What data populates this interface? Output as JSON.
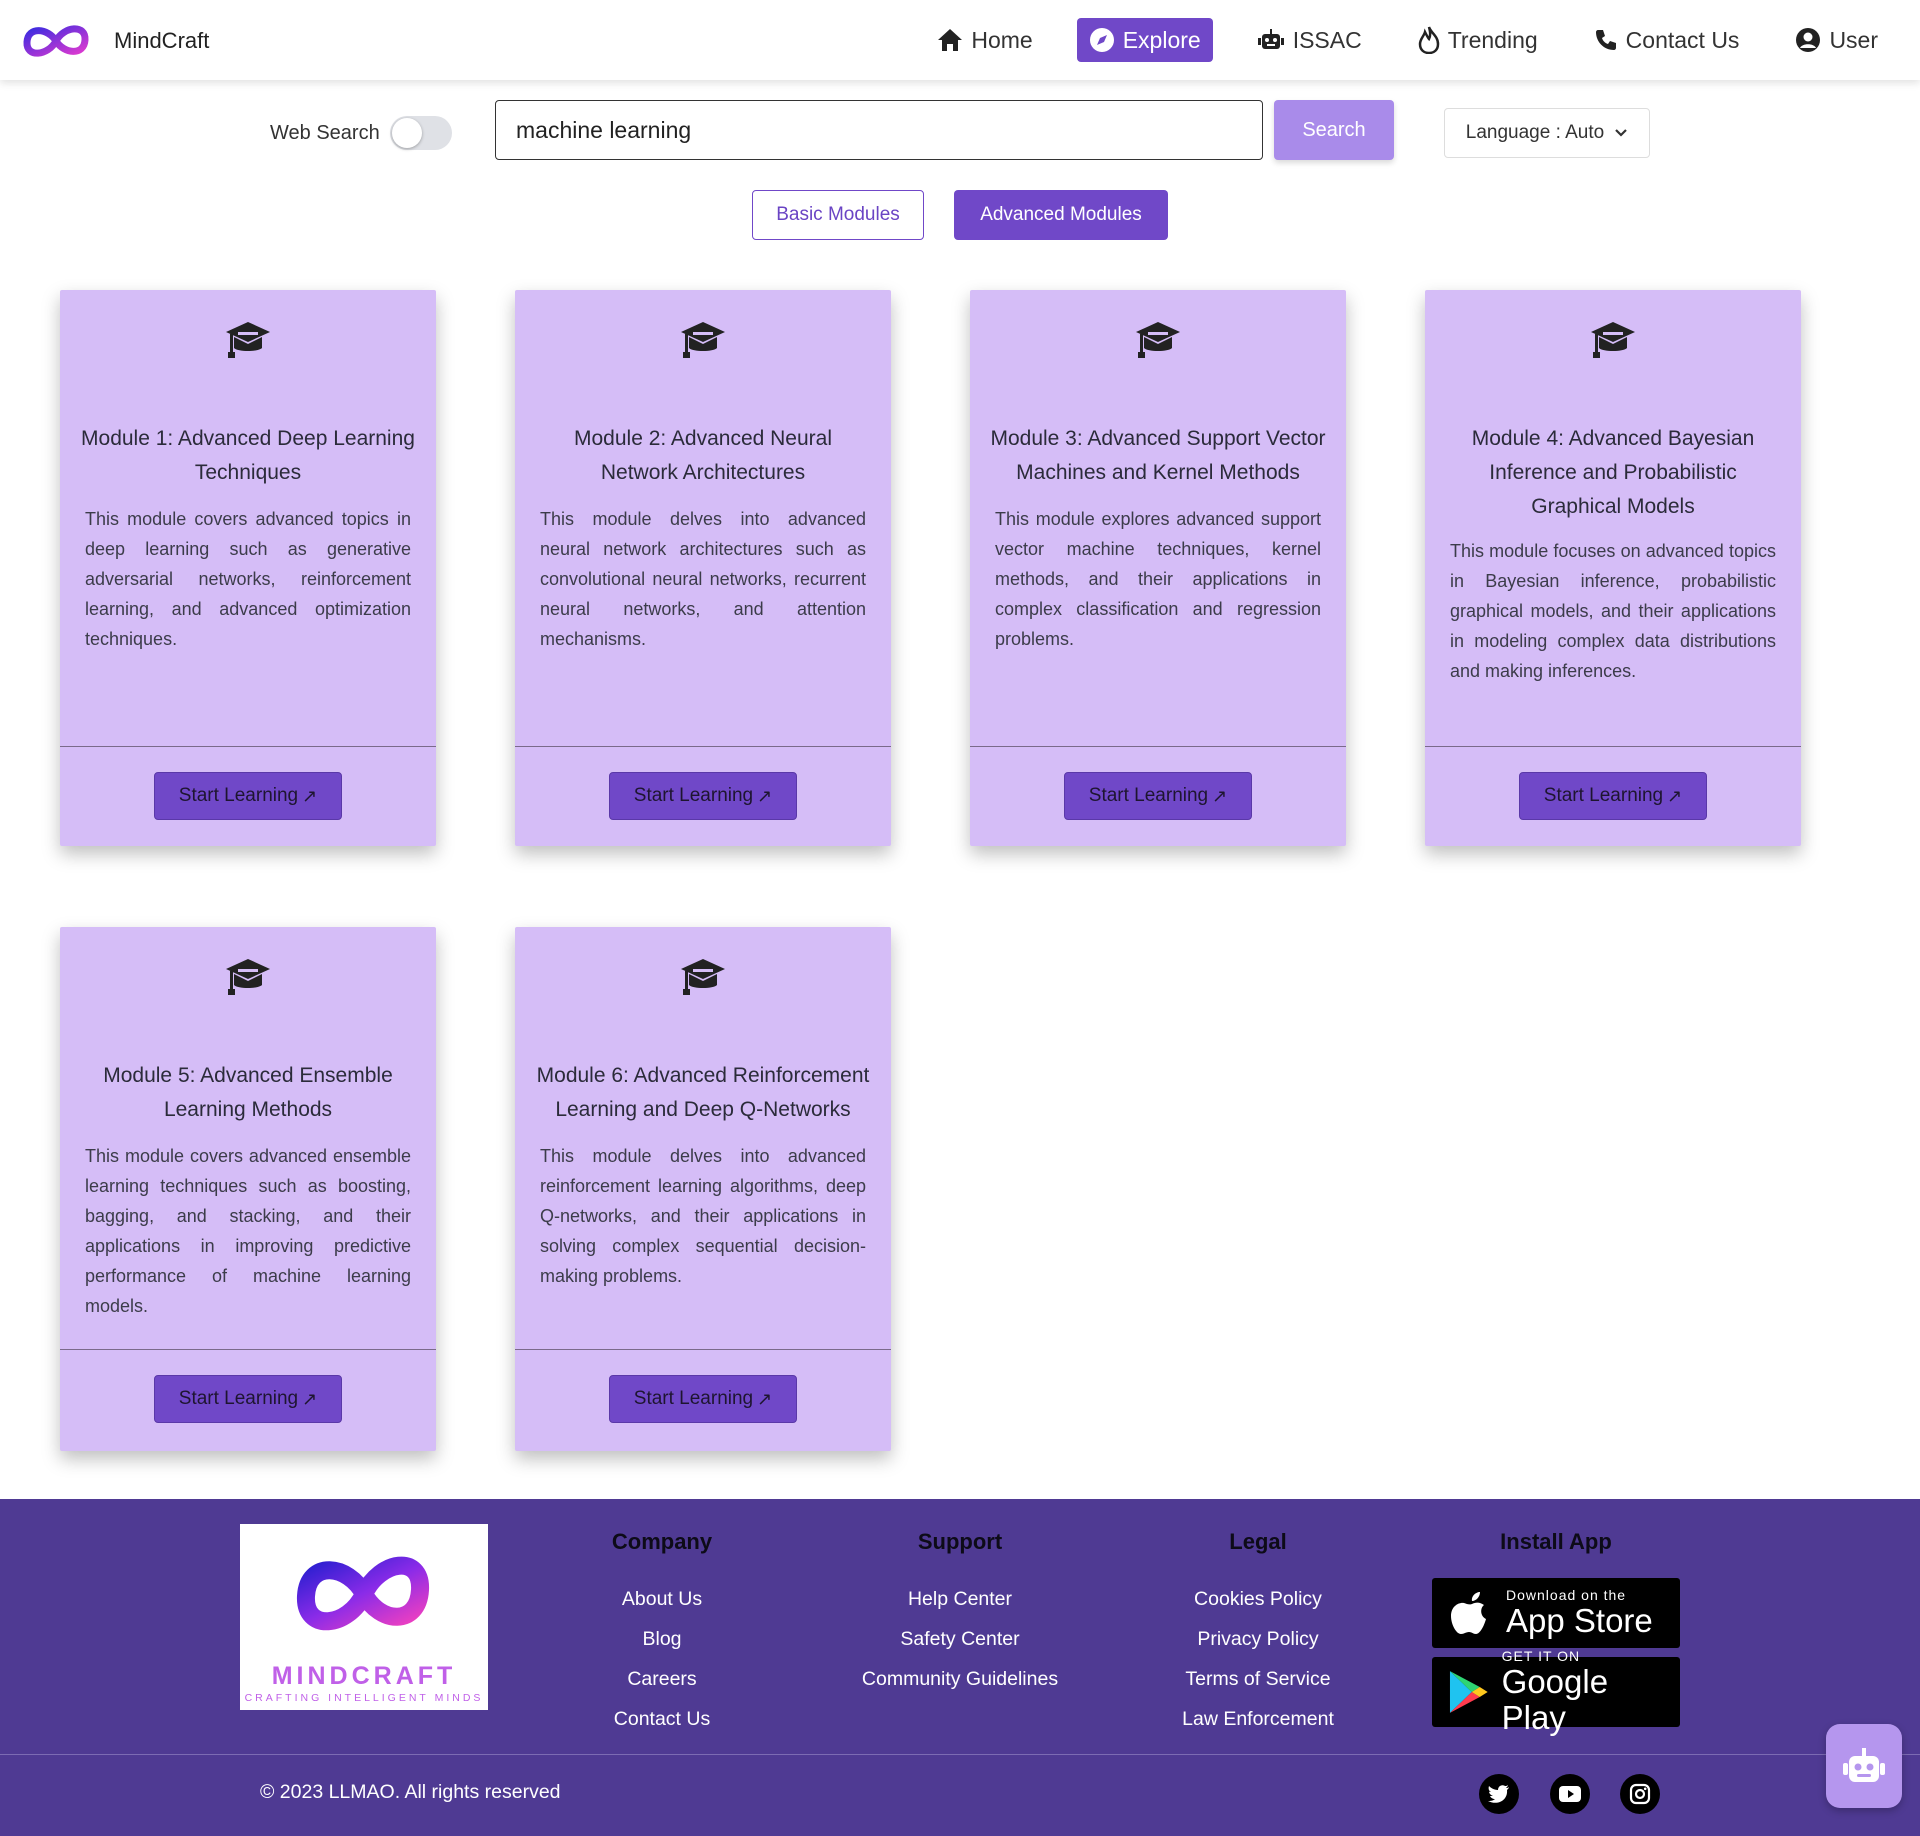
{
  "brand": {
    "name": "MindCraft"
  },
  "nav": {
    "items": [
      {
        "label": "Home",
        "icon": "home-icon"
      },
      {
        "label": "Explore",
        "icon": "compass-icon",
        "active": true
      },
      {
        "label": "ISSAC",
        "icon": "robot-icon"
      },
      {
        "label": "Trending",
        "icon": "fire-icon"
      },
      {
        "label": "Contact Us",
        "icon": "phone-icon"
      },
      {
        "label": "User",
        "icon": "user-circle-icon"
      }
    ]
  },
  "search": {
    "web_search_label": "Web Search",
    "web_search_on": false,
    "query": "machine learning",
    "button_label": "Search",
    "language_label": "Language : Auto"
  },
  "tabs": {
    "basic": "Basic Modules",
    "advanced": "Advanced Modules",
    "active": "advanced"
  },
  "colors": {
    "accent": "#7048c8",
    "card_bg": "#d5bdf7",
    "footer_bg": "#4f3a93",
    "search_btn": "#a98bea"
  },
  "modules": [
    {
      "title": "Module 1: Advanced Deep Learning Techniques",
      "description": "This module covers advanced topics in deep learning such as generative adversarial networks, reinforcement learning, and advanced optimization techniques.",
      "button": "Start Learning"
    },
    {
      "title": "Module 2: Advanced Neural Network Architectures",
      "description": "This module delves into advanced neural network architectures such as convolutional neural networks, recurrent neural networks, and attention mechanisms.",
      "button": "Start Learning"
    },
    {
      "title": "Module 3: Advanced Support Vector Machines and Kernel Methods",
      "description": "This module explores advanced support vector machine techniques, kernel methods, and their applications in complex classification and regression problems.",
      "button": "Start Learning"
    },
    {
      "title": "Module 4: Advanced Bayesian Inference and Probabilistic Graphical Models",
      "description": "This module focuses on advanced topics in Bayesian inference, probabilistic graphical models, and their applications in modeling complex data distributions and making inferences.",
      "button": "Start Learning"
    },
    {
      "title": "Module 5: Advanced Ensemble Learning Methods",
      "description": "This module covers advanced ensemble learning techniques such as boosting, bagging, and stacking, and their applications in improving predictive performance of machine learning models.",
      "button": "Start Learning"
    },
    {
      "title": "Module 6: Advanced Reinforcement Learning and Deep Q-Networks",
      "description": "This module delves into advanced reinforcement learning algorithms, deep Q-networks, and their applications in solving complex sequential decision-making problems.",
      "button": "Start Learning"
    }
  ],
  "footer": {
    "logo_word": "MINDCRAFT",
    "logo_tagline": "CRAFTING INTELLIGENT MINDS",
    "columns": [
      {
        "heading": "Company",
        "links": [
          "About Us",
          "Blog",
          "Careers",
          "Contact Us"
        ]
      },
      {
        "heading": "Support",
        "links": [
          "Help Center",
          "Safety Center",
          "Community Guidelines"
        ]
      },
      {
        "heading": "Legal",
        "links": [
          "Cookies Policy",
          "Privacy Policy",
          "Terms of Service",
          "Law Enforcement"
        ]
      }
    ],
    "install_heading": "Install App",
    "app_store": {
      "small": "Download on the",
      "big": "App Store"
    },
    "google_play": {
      "small": "GET IT ON",
      "big": "Google Play"
    },
    "copyright": "© 2023 LLMAO. All rights reserved",
    "social": [
      "twitter-icon",
      "youtube-icon",
      "instagram-icon"
    ]
  }
}
